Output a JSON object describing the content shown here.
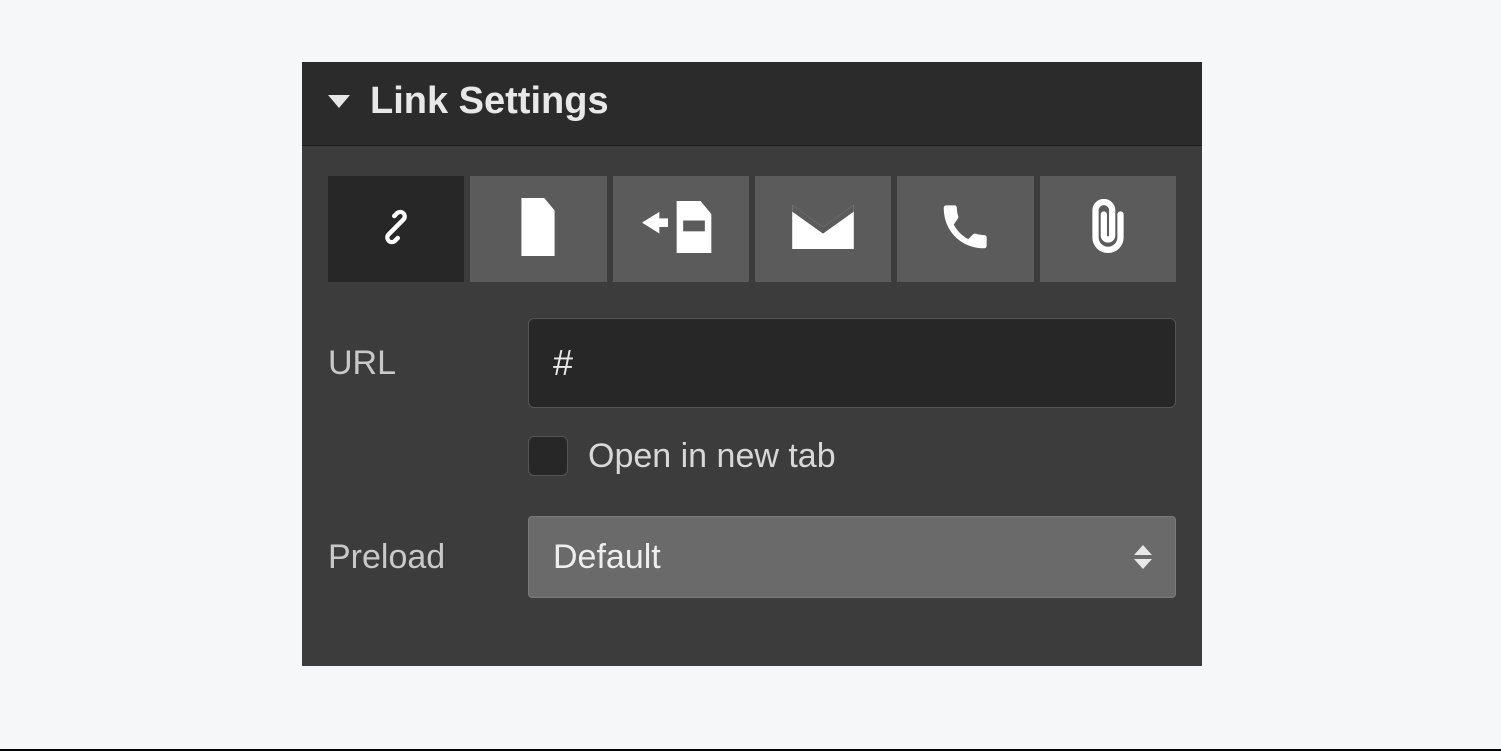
{
  "panel": {
    "title": "Link Settings"
  },
  "link_types": {
    "active_index": 0,
    "items": [
      {
        "name": "url",
        "icon": "link-icon"
      },
      {
        "name": "page",
        "icon": "page-icon"
      },
      {
        "name": "section",
        "icon": "page-section-icon"
      },
      {
        "name": "email",
        "icon": "email-icon"
      },
      {
        "name": "phone",
        "icon": "phone-icon"
      },
      {
        "name": "attachment",
        "icon": "attachment-icon"
      }
    ]
  },
  "url": {
    "label": "URL",
    "value": "#"
  },
  "open_new_tab": {
    "label": "Open in new tab",
    "checked": false
  },
  "preload": {
    "label": "Preload",
    "value": "Default"
  }
}
